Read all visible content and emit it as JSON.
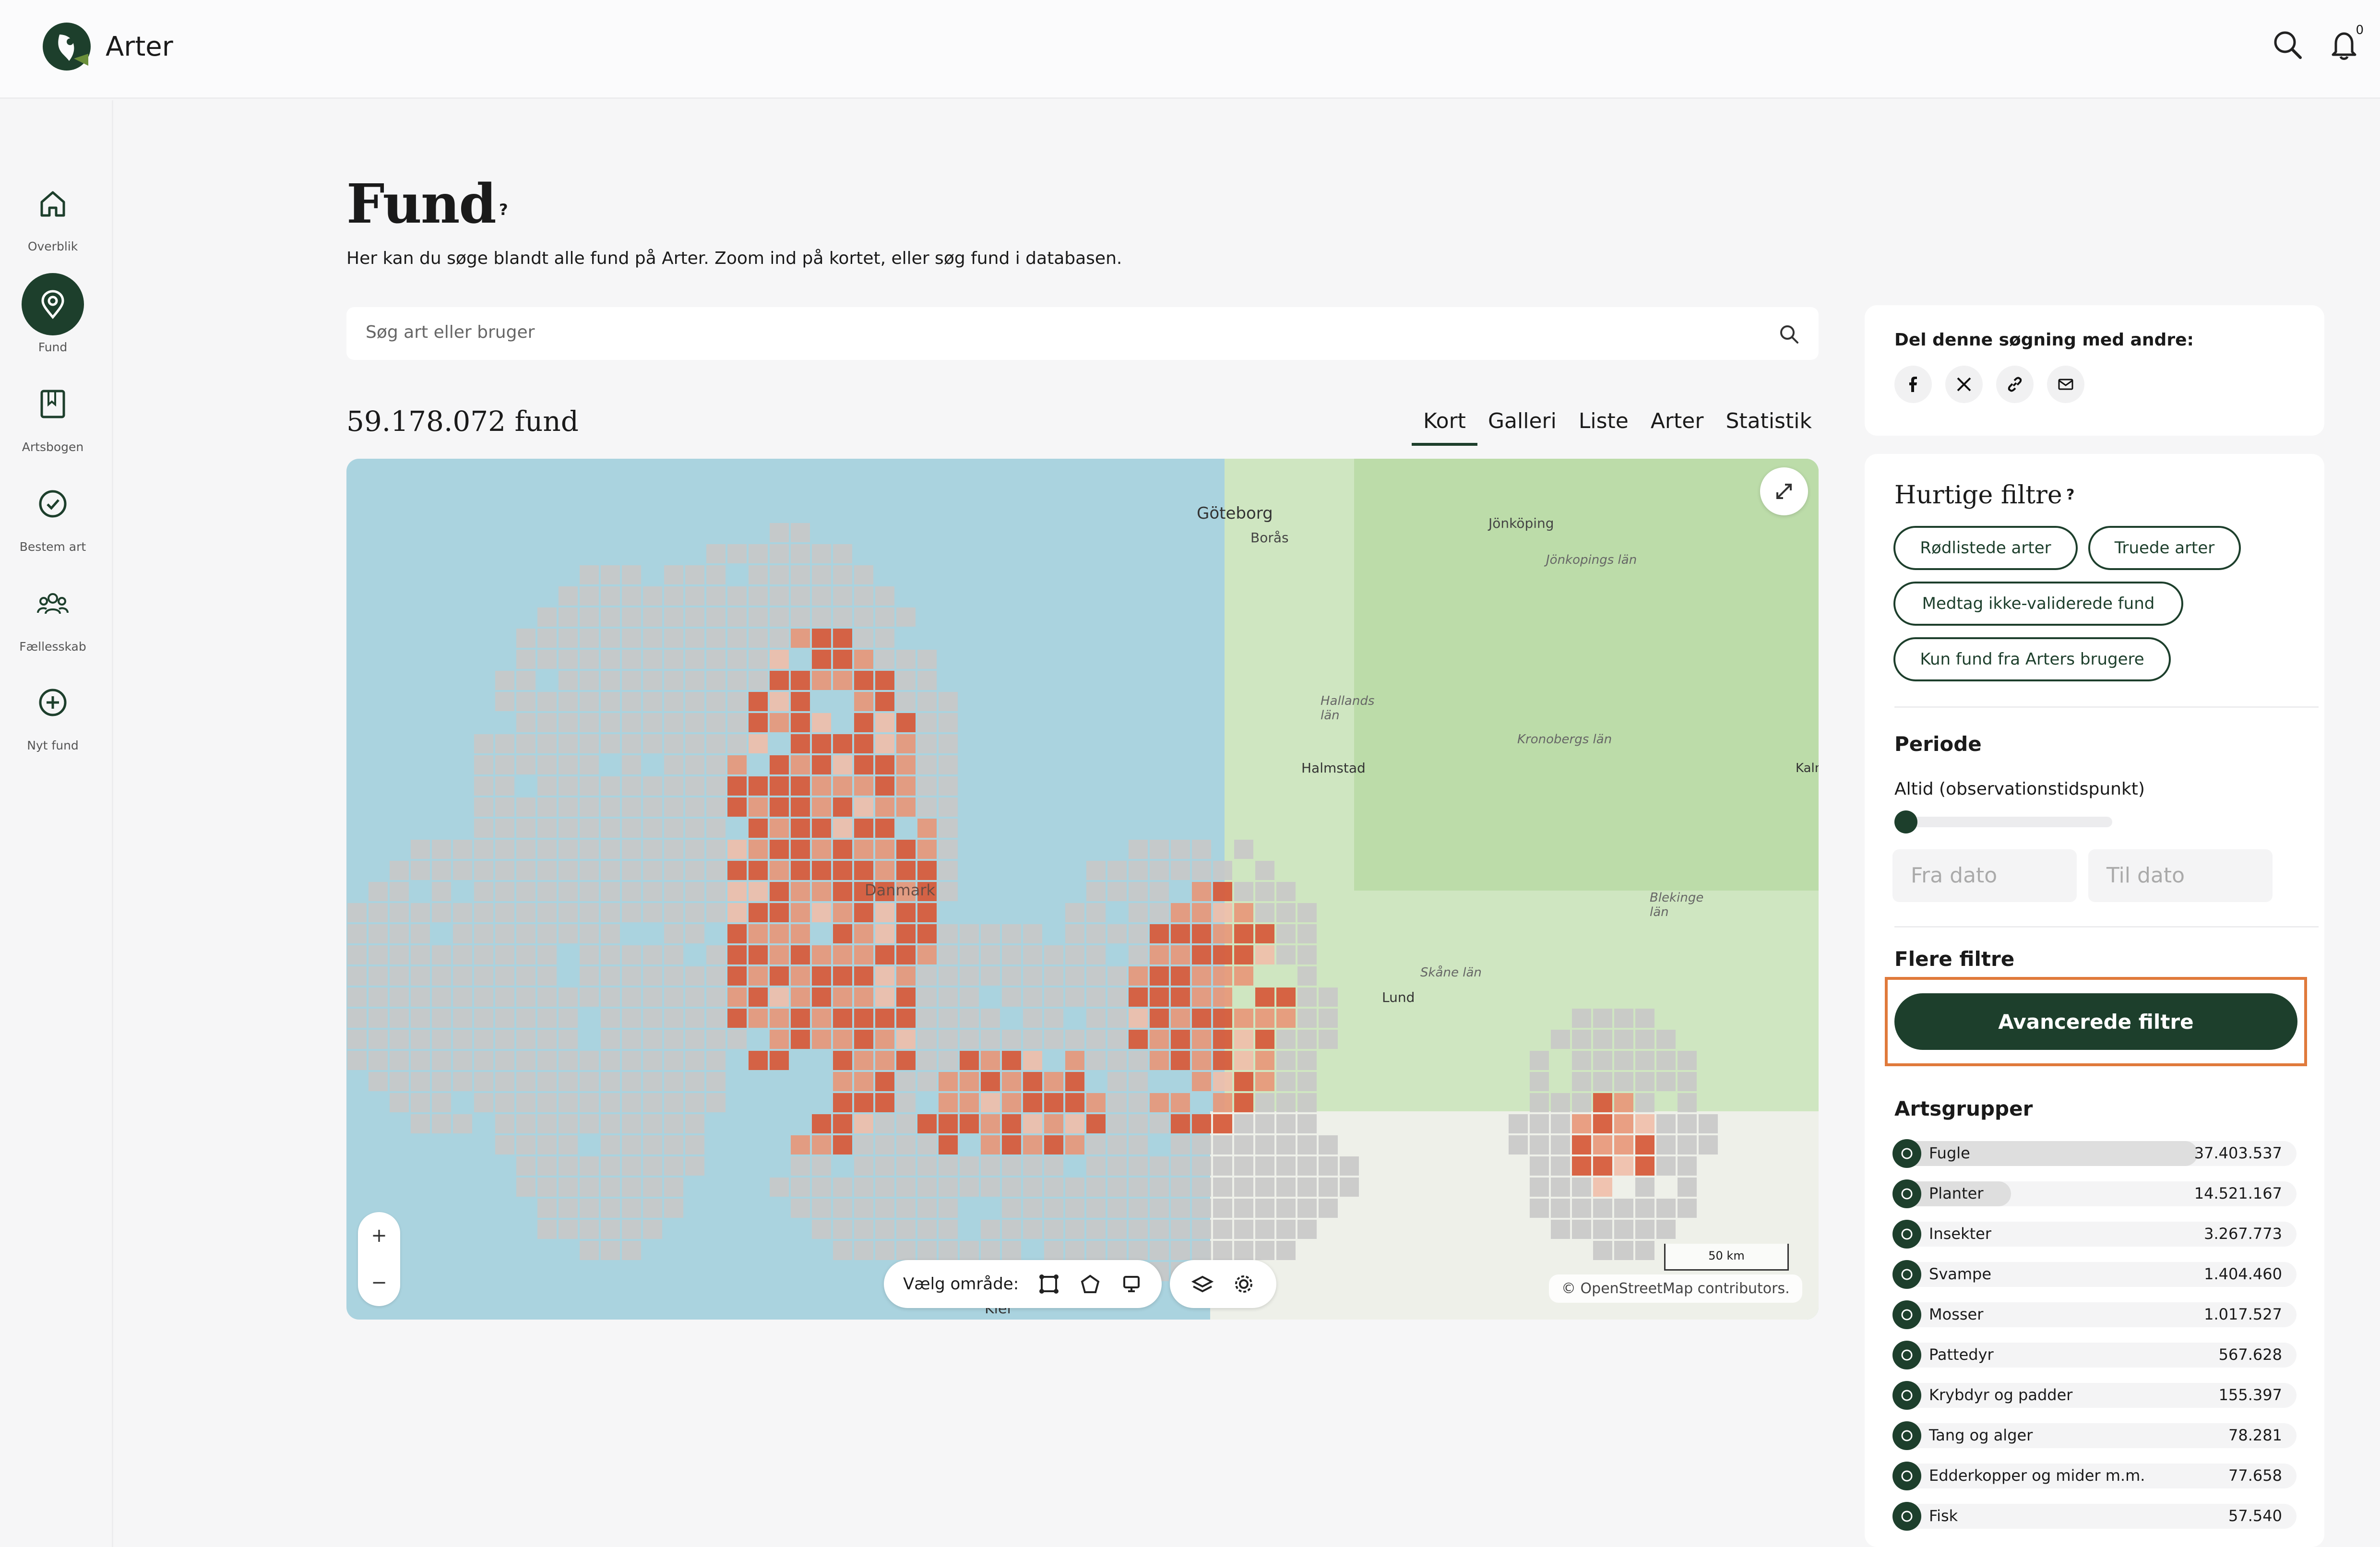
{
  "app": {
    "name": "Arter",
    "notification_count": "0"
  },
  "sidebar": {
    "items": [
      {
        "label": "Overblik",
        "icon": "home-icon"
      },
      {
        "label": "Fund",
        "icon": "map-pin-icon",
        "active": true
      },
      {
        "label": "Artsbogen",
        "icon": "book-icon"
      },
      {
        "label": "Bestem art",
        "icon": "check-circle-icon"
      },
      {
        "label": "Fællesskab",
        "icon": "people-icon"
      },
      {
        "label": "Nyt fund",
        "icon": "plus-circle-icon"
      }
    ]
  },
  "page": {
    "title": "Fund",
    "help": "?",
    "subtitle": "Her kan du søge blandt alle fund på Arter. Zoom ind på kortet, eller søg fund i databasen."
  },
  "search": {
    "placeholder": "Søg art eller bruger"
  },
  "results": {
    "count": "59.178.072 fund",
    "tabs": [
      "Kort",
      "Galleri",
      "Liste",
      "Arter",
      "Statistik"
    ],
    "active_tab": "Kort"
  },
  "map": {
    "labels": [
      "Göteborg",
      "Borås",
      "Jönköping",
      "Jönkopings län",
      "Hallands län",
      "Halmstad",
      "Kronobergs län",
      "Blekinge län",
      "Skåne län",
      "Lund",
      "Danmark",
      "Kiel",
      "Kaln"
    ],
    "zoom_in": "+",
    "zoom_out": "−",
    "area_label": "Vælg område:",
    "scale": "50 km",
    "attribution": "© OpenStreetMap contributors."
  },
  "share": {
    "title": "Del denne søgning med andre:"
  },
  "quick_filters": {
    "title": "Hurtige filtre",
    "help": "?",
    "chips": [
      "Rødlistede arter",
      "Truede arter",
      "Medtag ikke-validerede fund",
      "Kun fund fra Arters brugere"
    ]
  },
  "period": {
    "title": "Periode",
    "label": "Altid (observationstidspunkt)",
    "from_placeholder": "Fra dato",
    "to_placeholder": "Til dato"
  },
  "more_filters": {
    "title": "Flere filtre",
    "button": "Avancerede filtre"
  },
  "species_groups": {
    "title": "Artsgrupper",
    "items": [
      {
        "name": "Fugle",
        "value": "37.403.537",
        "share": 1.0
      },
      {
        "name": "Planter",
        "value": "14.521.167",
        "share": 0.388
      },
      {
        "name": "Insekter",
        "value": "3.267.773",
        "share": 0.087
      },
      {
        "name": "Svampe",
        "value": "1.404.460",
        "share": 0.038
      },
      {
        "name": "Mosser",
        "value": "1.017.527",
        "share": 0.027
      },
      {
        "name": "Pattedyr",
        "value": "567.628",
        "share": 0.015
      },
      {
        "name": "Krybdyr og padder",
        "value": "155.397",
        "share": 0.004
      },
      {
        "name": "Tang og alger",
        "value": "78.281",
        "share": 0.002
      },
      {
        "name": "Edderkopper og mider m.m.",
        "value": "77.658",
        "share": 0.002
      },
      {
        "name": "Fisk",
        "value": "57.540",
        "share": 0.0015
      }
    ]
  }
}
